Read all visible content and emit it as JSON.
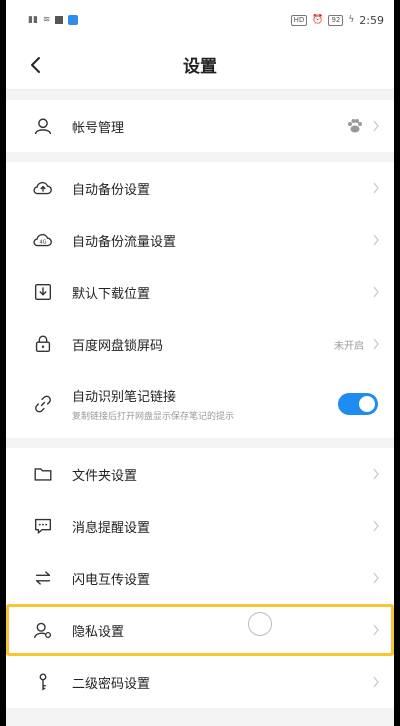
{
  "status_bar": {
    "left": "",
    "hd": "HD",
    "battery": "92",
    "time": "2:59"
  },
  "header": {
    "title": "设置"
  },
  "account": {
    "label": "帐号管理"
  },
  "items": [
    {
      "label": "自动备份设置"
    },
    {
      "label": "自动备份流量设置"
    },
    {
      "label": "默认下载位置"
    },
    {
      "label": "百度网盘锁屏码",
      "status": "未开启"
    },
    {
      "label": "自动识别笔记链接",
      "sub": "复制链接后打开网盘显示保存笔记的提示",
      "toggle_on": true
    }
  ],
  "items2": [
    {
      "label": "文件夹设置"
    },
    {
      "label": "消息提醒设置"
    },
    {
      "label": "闪电互传设置"
    },
    {
      "label": "隐私设置"
    },
    {
      "label": "二级密码设置"
    }
  ],
  "colors": {
    "accent": "#1e8cf0",
    "highlight": "#f7c632"
  },
  "icons": {
    "account": "user-icon",
    "backup": "cloud-upload-icon",
    "traffic": "cloud-4g-icon",
    "download": "download-icon",
    "lock": "lock-icon",
    "link": "link-icon",
    "folder": "folder-icon",
    "message": "message-icon",
    "transfer": "transfer-arrows-icon",
    "privacy": "privacy-user-icon",
    "key": "key-icon"
  }
}
